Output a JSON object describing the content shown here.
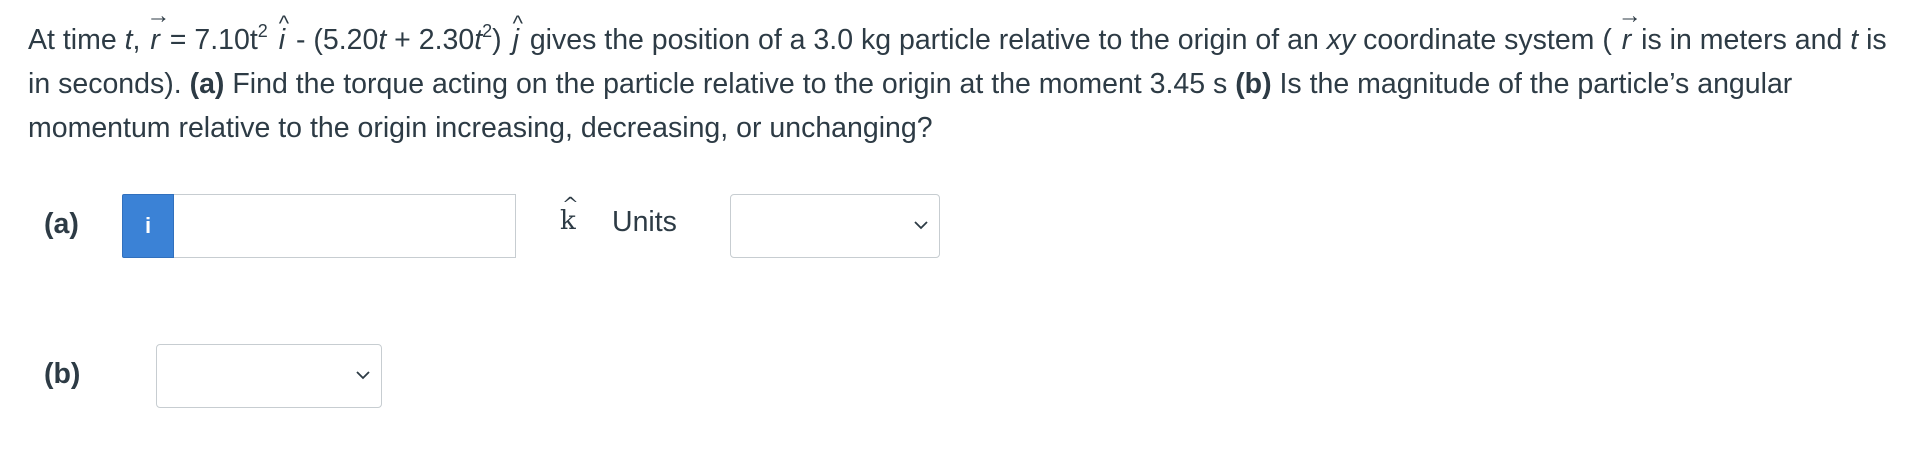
{
  "question": {
    "p1": "At time ",
    "t1": "t",
    "p2": ", ",
    "r1": "r",
    "p3": " = 7.10t",
    "exp1": "2",
    "ihat": "i",
    "p4": " - (5.20",
    "t2": "t",
    "p5": " + 2.30",
    "t3": "t",
    "exp2": "2",
    "p6": ") ",
    "jhat": "j",
    "p7": " gives the position of a 3.0 kg particle relative to the origin of an ",
    "xy": "xy",
    "p8": " coordinate system ( ",
    "r2": "r",
    "p9": " is in meters and ",
    "t4": "t",
    "p10": " is in seconds). ",
    "a_label": "(a)",
    "p11": " Find the torque acting on the particle relative to the origin at the moment 3.45 s ",
    "b_label": "(b)",
    "p12": " Is the magnitude of the particle’s angular momentum relative to the origin increasing, decreasing, or unchanging?"
  },
  "part_a": {
    "label": "(a)",
    "info_icon": "info-icon",
    "input_value": "",
    "unit_vector": "k",
    "units_label": "Units",
    "units_selected": ""
  },
  "part_b": {
    "label": "(b)",
    "selected": ""
  },
  "colors": {
    "text": "#2d3b45",
    "info_button": "#3b82d6",
    "border": "#c7cdd1"
  }
}
